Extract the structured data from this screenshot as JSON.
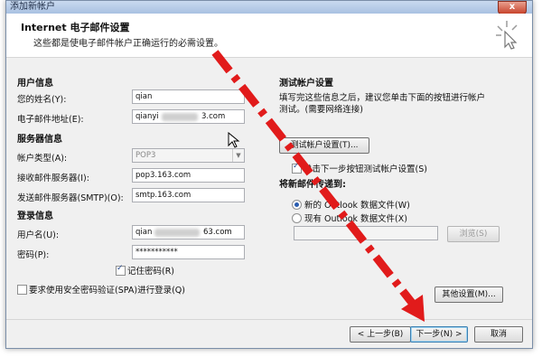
{
  "window": {
    "title": "添加新帐户",
    "close_label": "x"
  },
  "header": {
    "title": "Internet 电子邮件设置",
    "subtitle": "这些都是使电子邮件帐户正确运行的必需设置。",
    "icon": "cursor-sparkle-icon"
  },
  "user_info": {
    "section": "用户信息",
    "name_label": "您的姓名(Y):",
    "name_value": "qian",
    "email_label": "电子邮件地址(E):",
    "email_value_start": "qianyi",
    "email_value_end": "3.com"
  },
  "server_info": {
    "section": "服务器信息",
    "account_type_label": "帐户类型(A):",
    "account_type_value": "POP3",
    "incoming_label": "接收邮件服务器(I):",
    "incoming_value": "pop3.163.com",
    "outgoing_label": "发送邮件服务器(SMTP)(O):",
    "outgoing_value": "smtp.163.com"
  },
  "login_info": {
    "section": "登录信息",
    "username_label": "用户名(U):",
    "username_value_start": "qian",
    "username_value_end": "63.com",
    "password_label": "密码(P):",
    "password_value": "***********",
    "remember_label": "记住密码(R)",
    "remember_checked": true
  },
  "spa": {
    "label": "要求使用安全密码验证(SPA)进行登录(Q)",
    "checked": false
  },
  "test": {
    "section": "测试帐户设置",
    "description_line1": "填写完这些信息之后，建议您单击下面的按钮进行帐户",
    "description_line2": "测试。(需要网络连接)",
    "button": "测试帐户设置(T)...",
    "auto_test_label": "单击下一步按钮测试帐户设置(S)",
    "auto_test_checked": true
  },
  "deliver": {
    "section": "将新邮件传递到:",
    "new_file_label": "新的 Outlook 数据文件(W)",
    "existing_file_label": "现有 Outlook 数据文件(X)",
    "selected": "new",
    "browse_button": "浏览(S)"
  },
  "more_settings_button": "其他设置(M)...",
  "footer": {
    "back_button": "< 上一步(B)",
    "next_button": "下一步(N) >",
    "cancel_button": "取消"
  },
  "overlay": {
    "arrow_color": "#e11b1b"
  }
}
